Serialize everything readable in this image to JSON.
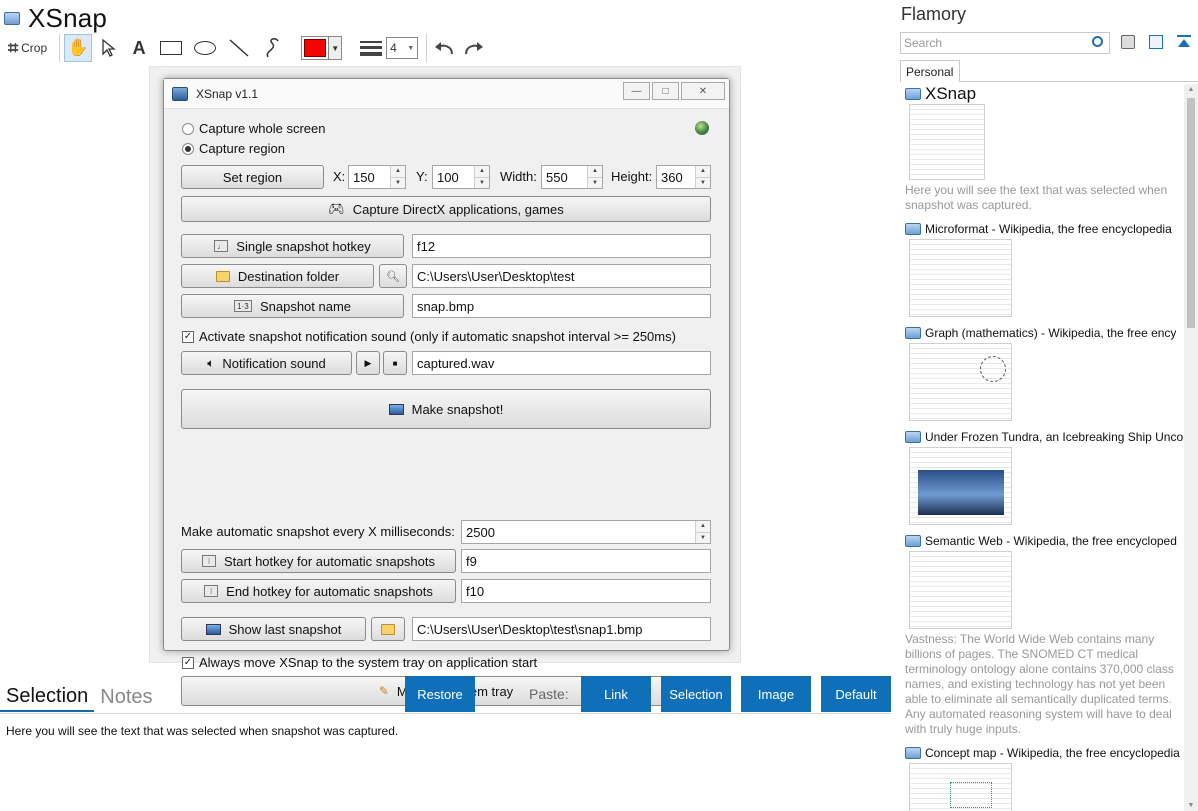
{
  "app": {
    "title": "XSnap"
  },
  "toolbar": {
    "crop_label": "Crop",
    "line_width": "4",
    "color": "#ff0000"
  },
  "xsnap_window": {
    "title": "XSnap v1.1",
    "capture_whole_screen": "Capture whole screen",
    "capture_region": "Capture region",
    "set_region": "Set region",
    "x_label": "X:",
    "x_value": "150",
    "y_label": "Y:",
    "y_value": "100",
    "width_label": "Width:",
    "width_value": "550",
    "height_label": "Height:",
    "height_value": "360",
    "capture_directx": "Capture DirectX applications, games",
    "single_hotkey_label": "Single snapshot hotkey",
    "single_hotkey_value": "f12",
    "destination_label": "Destination folder",
    "destination_value": "C:\\Users\\User\\Desktop\\test",
    "snapshot_name_label": "Snapshot name",
    "snapshot_name_value": "snap.bmp",
    "notification_check": "Activate snapshot notification sound (only if automatic snapshot interval >= 250ms)",
    "notification_sound_label": "Notification sound",
    "notification_sound_value": "captured.wav",
    "make_snapshot": "Make snapshot!",
    "auto_interval_label": "Make automatic snapshot every X milliseconds:",
    "auto_interval_value": "2500",
    "start_hotkey_label": "Start hotkey for automatic snapshots",
    "start_hotkey_value": "f9",
    "end_hotkey_label": "End hotkey for automatic snapshots",
    "end_hotkey_value": "f10",
    "show_last_label": "Show last snapshot",
    "show_last_value": "C:\\Users\\User\\Desktop\\test\\snap1.bmp",
    "tray_check": "Always move XSnap to the system tray on application start",
    "move_tray": "Move to system tray"
  },
  "bottom": {
    "tab_selection": "Selection",
    "tab_notes": "Notes",
    "restore": "Restore",
    "paste_label": "Paste:",
    "paste_link": "Link",
    "paste_selection": "Selection",
    "paste_image": "Image",
    "paste_default": "Default",
    "selection_text": "Here you will see the text that was selected when snapshot was captured."
  },
  "flamory": {
    "title": "Flamory",
    "search_placeholder": "Search",
    "tab_personal": "Personal",
    "items": [
      {
        "title": "XSnap",
        "desc": "Here you will see the text that was selected when snapshot was captured."
      },
      {
        "title": "Microformat - Wikipedia, the free encyclopedia",
        "desc": ""
      },
      {
        "title": "Graph (mathematics) - Wikipedia, the free ency",
        "desc": ""
      },
      {
        "title": "Under Frozen Tundra, an Icebreaking Ship Unco",
        "desc": ""
      },
      {
        "title": "Semantic Web - Wikipedia, the free encycloped",
        "desc": "Vastness: The World Wide Web contains many billions of pages. The SNOMED CT medical terminology ontology alone contains 370,000 class names, and existing technology has not yet been able to eliminate all semantically duplicated terms. Any automated reasoning system will have to deal with truly huge inputs."
      },
      {
        "title": "Concept map - Wikipedia, the free encyclopedia",
        "desc": ""
      }
    ]
  }
}
